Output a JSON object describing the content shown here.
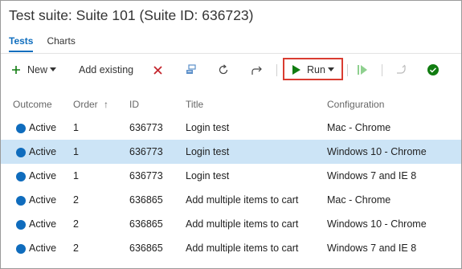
{
  "header": {
    "title": "Test suite: Suite 101 (Suite ID: 636723)"
  },
  "tabs": [
    {
      "label": "Tests",
      "active": true
    },
    {
      "label": "Charts",
      "active": false
    }
  ],
  "toolbar": {
    "new_label": "New",
    "add_existing_label": "Add existing",
    "run_label": "Run",
    "icons": [
      "plus-icon",
      "caret-down-icon",
      "delete-icon",
      "workitem-link-icon",
      "refresh-icon",
      "redo-arrow-icon",
      "play-icon",
      "resume-icon",
      "undo-arrow-icon",
      "check-circle-icon"
    ],
    "colors": {
      "add": "#107c10",
      "delete": "#c4262e",
      "run": "#107c10",
      "run_highlight": "#d93c31",
      "accent": "#106ebe"
    }
  },
  "table": {
    "columns": [
      "Outcome",
      "Order",
      "ID",
      "Title",
      "Configuration"
    ],
    "sort_indicator": "↑",
    "rows": [
      {
        "outcome": "Active",
        "order": "1",
        "id": "636773",
        "title": "Login test",
        "configuration": "Mac - Chrome",
        "selected": false
      },
      {
        "outcome": "Active",
        "order": "1",
        "id": "636773",
        "title": "Login test",
        "configuration": "Windows 10 - Chrome",
        "selected": true
      },
      {
        "outcome": "Active",
        "order": "1",
        "id": "636773",
        "title": "Login test",
        "configuration": "Windows 7 and IE 8",
        "selected": false
      },
      {
        "outcome": "Active",
        "order": "2",
        "id": "636865",
        "title": "Add multiple items to cart",
        "configuration": "Mac - Chrome",
        "selected": false
      },
      {
        "outcome": "Active",
        "order": "2",
        "id": "636865",
        "title": "Add multiple items to cart",
        "configuration": "Windows 10 - Chrome",
        "selected": false
      },
      {
        "outcome": "Active",
        "order": "2",
        "id": "636865",
        "title": "Add multiple items to cart",
        "configuration": "Windows 7 and IE 8",
        "selected": false
      }
    ]
  }
}
